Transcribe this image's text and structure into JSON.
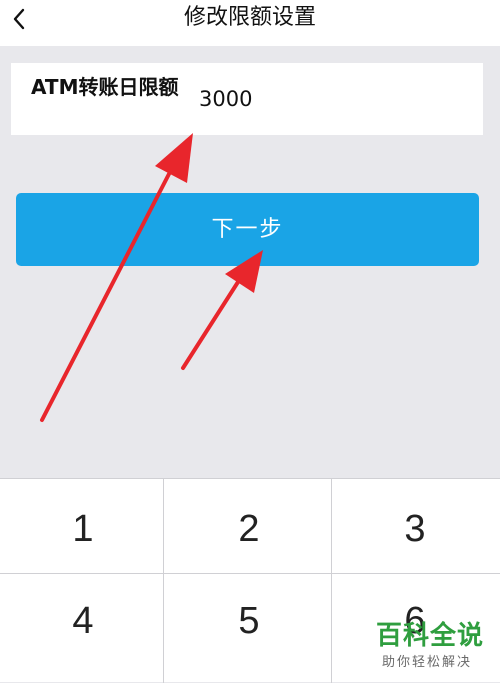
{
  "header": {
    "title": "修改限额设置",
    "back_icon": "chevron-left-icon"
  },
  "limit_form": {
    "label": "ATM转账日限额",
    "value": "3000"
  },
  "next_button": {
    "label": "下一步"
  },
  "keypad": {
    "keys": [
      "1",
      "2",
      "3",
      "4",
      "5",
      "6"
    ]
  },
  "annotations": {
    "arrow_color": "#e8262c",
    "count": 2
  },
  "watermark": {
    "title": "百科全说",
    "subtitle": "助你轻松解决"
  },
  "colors": {
    "accent": "#1aa4e6",
    "background": "#e8e8ec",
    "watermark_green": "#2f9e3f"
  }
}
